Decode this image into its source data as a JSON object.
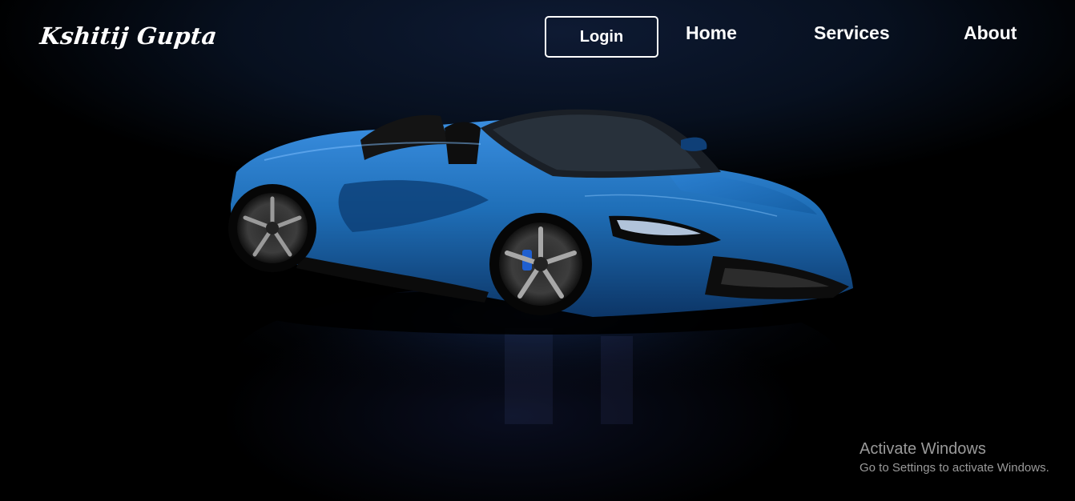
{
  "header": {
    "brand": "Kshitij Gupta",
    "login_label": "Login",
    "nav": {
      "home": "Home",
      "services": "Services",
      "about": "About"
    }
  },
  "hero": {
    "image": "blue-convertible-sports-car"
  },
  "watermark": {
    "title": "Activate Windows",
    "subtitle": "Go to Settings to activate Windows."
  },
  "colors": {
    "background": "#000000",
    "text": "#ffffff",
    "car_body": "#1f6fb8",
    "watermark_text": "#9a9a9a"
  }
}
